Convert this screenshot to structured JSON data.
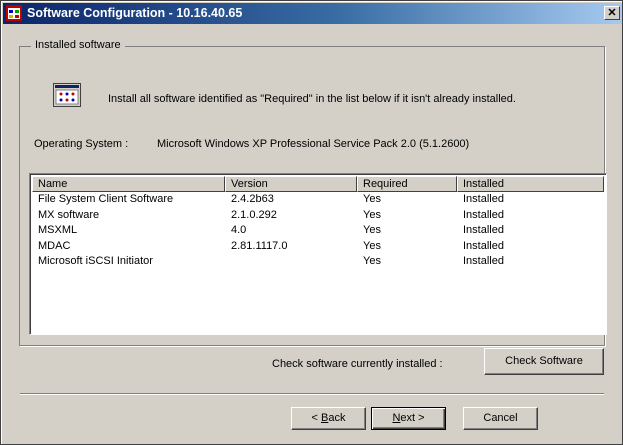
{
  "window": {
    "title": "Software Configuration - 10.16.40.65",
    "close_label": "✕"
  },
  "group": {
    "legend": "Installed software",
    "info_text": "Install all software identified as \"Required\" in the list below if it isn't already installed."
  },
  "os": {
    "label": "Operating System :",
    "value": "Microsoft Windows XP Professional Service Pack 2.0 (5.1.2600)"
  },
  "list": {
    "columns": [
      "Name",
      "Version",
      "Required",
      "Installed"
    ],
    "rows": [
      [
        "File System Client Software",
        "2.4.2b63",
        "Yes",
        "Installed"
      ],
      [
        "MX software",
        "2.1.0.292",
        "Yes",
        "Installed"
      ],
      [
        "MSXML",
        "4.0",
        "Yes",
        "Installed"
      ],
      [
        "MDAC",
        "2.81.1117.0",
        "Yes",
        "Installed"
      ],
      [
        "Microsoft iSCSI Initiator",
        "",
        "Yes",
        "Installed"
      ]
    ]
  },
  "check": {
    "label": "Check software currently installed :",
    "button": "Check Software"
  },
  "footer": {
    "back_prefix": "< ",
    "back_key": "B",
    "back_rest": "ack",
    "next_key": "N",
    "next_rest": "ext >",
    "cancel": "Cancel"
  },
  "icons": {
    "title_icon": "app-window-icon",
    "info_icon": "software-list-icon"
  }
}
